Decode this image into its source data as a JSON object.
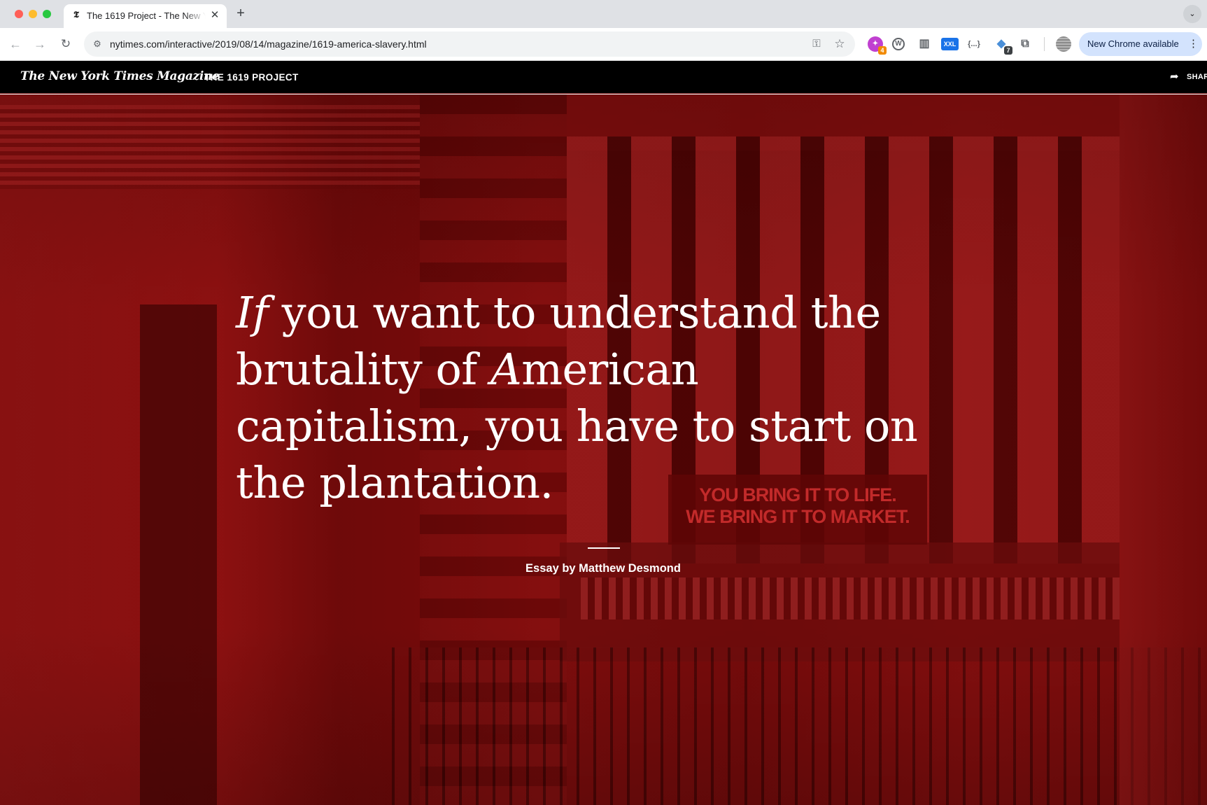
{
  "browser": {
    "tab": {
      "title": "The 1619 Project - The New York Times",
      "favicon_icon": "nyt-t-icon"
    },
    "new_tab_symbol": "+",
    "tab_menu_symbol": "⌄",
    "url": "nytimes.com/interactive/2019/08/14/magazine/1619-america-slavery.html",
    "extensions": [
      {
        "icon": "puzzle-piece-icon",
        "badge": "4"
      },
      {
        "icon": "wordpress-icon"
      },
      {
        "icon": "archive-icon"
      },
      {
        "icon": "xxl-icon",
        "label": "XXL"
      },
      {
        "icon": "json-viewer-icon",
        "label": "{...}"
      },
      {
        "icon": "tracker-icon",
        "badge": "7"
      },
      {
        "icon": "extensions-icon"
      }
    ],
    "update_button": "New Chrome available"
  },
  "header": {
    "masthead": "The New York Times Magazine",
    "project_label": "THE 1619 PROJECT",
    "share_label": "SHARE"
  },
  "hero": {
    "quote": {
      "initial": "If",
      "part1": " you want to understand the brutality of ",
      "american_initial": "A",
      "part2": "merican capitalism, you have to start on the plantation."
    },
    "byline": "Essay by Matthew Desmond",
    "background_banner": {
      "line1": "YOU BRING IT TO LIFE.",
      "line2": "WE BRING IT TO MARKET."
    },
    "overlay_color": "#8b0d0d"
  }
}
